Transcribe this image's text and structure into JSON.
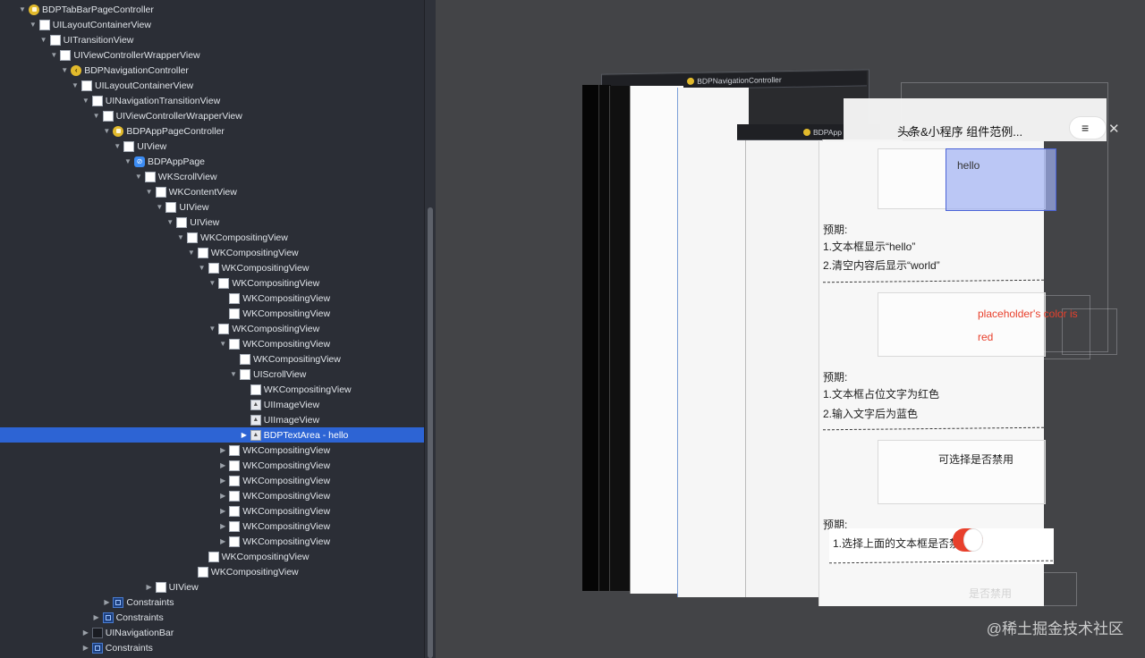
{
  "navigator": {
    "rows": [
      {
        "label": "BDPTabBarPageController",
        "indent": 0,
        "icon": "controller",
        "disclosure": "expanded"
      },
      {
        "label": "UILayoutContainerView",
        "indent": 1,
        "icon": "view",
        "disclosure": "expanded"
      },
      {
        "label": "UITransitionView",
        "indent": 2,
        "icon": "view",
        "disclosure": "expanded"
      },
      {
        "label": "UIViewControllerWrapperView",
        "indent": 3,
        "icon": "view",
        "disclosure": "expanded"
      },
      {
        "label": "BDPNavigationController",
        "indent": 4,
        "icon": "nav-controller",
        "disclosure": "expanded"
      },
      {
        "label": "UILayoutContainerView",
        "indent": 5,
        "icon": "view",
        "disclosure": "expanded"
      },
      {
        "label": "UINavigationTransitionView",
        "indent": 6,
        "icon": "view",
        "disclosure": "expanded"
      },
      {
        "label": "UIViewControllerWrapperView",
        "indent": 7,
        "icon": "view",
        "disclosure": "expanded"
      },
      {
        "label": "BDPAppPageController",
        "indent": 8,
        "icon": "controller",
        "disclosure": "expanded"
      },
      {
        "label": "UIView",
        "indent": 9,
        "icon": "view",
        "disclosure": "expanded"
      },
      {
        "label": "BDPAppPage",
        "indent": 10,
        "icon": "web",
        "disclosure": "expanded"
      },
      {
        "label": "WKScrollView",
        "indent": 11,
        "icon": "view",
        "disclosure": "expanded"
      },
      {
        "label": "WKContentView",
        "indent": 12,
        "icon": "view",
        "disclosure": "expanded"
      },
      {
        "label": "UIView",
        "indent": 13,
        "icon": "view",
        "disclosure": "expanded"
      },
      {
        "label": "UIView",
        "indent": 14,
        "icon": "view",
        "disclosure": "expanded"
      },
      {
        "label": "WKCompositingView",
        "indent": 15,
        "icon": "view",
        "disclosure": "expanded"
      },
      {
        "label": "WKCompositingView",
        "indent": 16,
        "icon": "view",
        "disclosure": "expanded"
      },
      {
        "label": "WKCompositingView",
        "indent": 17,
        "icon": "view",
        "disclosure": "expanded"
      },
      {
        "label": "WKCompositingView",
        "indent": 18,
        "icon": "view",
        "disclosure": "expanded"
      },
      {
        "label": "WKCompositingView",
        "indent": 19,
        "icon": "view",
        "disclosure": "none"
      },
      {
        "label": "WKCompositingView",
        "indent": 19,
        "icon": "view",
        "disclosure": "none"
      },
      {
        "label": "WKCompositingView",
        "indent": 18,
        "icon": "view",
        "disclosure": "expanded"
      },
      {
        "label": "WKCompositingView",
        "indent": 19,
        "icon": "view",
        "disclosure": "expanded"
      },
      {
        "label": "WKCompositingView",
        "indent": 20,
        "icon": "view",
        "disclosure": "none"
      },
      {
        "label": "UIScrollView",
        "indent": 20,
        "icon": "view",
        "disclosure": "expanded"
      },
      {
        "label": "WKCompositingView",
        "indent": 21,
        "icon": "view",
        "disclosure": "none"
      },
      {
        "label": "UIImageView",
        "indent": 21,
        "icon": "image",
        "disclosure": "none"
      },
      {
        "label": "UIImageView",
        "indent": 21,
        "icon": "image",
        "disclosure": "none"
      },
      {
        "label": "BDPTextArea - hello",
        "indent": 21,
        "icon": "image",
        "disclosure": "collapsed",
        "selected": true
      },
      {
        "label": "WKCompositingView",
        "indent": 19,
        "icon": "view",
        "disclosure": "collapsed"
      },
      {
        "label": "WKCompositingView",
        "indent": 19,
        "icon": "view",
        "disclosure": "collapsed"
      },
      {
        "label": "WKCompositingView",
        "indent": 19,
        "icon": "view",
        "disclosure": "collapsed"
      },
      {
        "label": "WKCompositingView",
        "indent": 19,
        "icon": "view",
        "disclosure": "collapsed"
      },
      {
        "label": "WKCompositingView",
        "indent": 19,
        "icon": "view",
        "disclosure": "collapsed"
      },
      {
        "label": "WKCompositingView",
        "indent": 19,
        "icon": "view",
        "disclosure": "collapsed"
      },
      {
        "label": "WKCompositingView",
        "indent": 19,
        "icon": "view",
        "disclosure": "collapsed"
      },
      {
        "label": "WKCompositingView",
        "indent": 17,
        "icon": "view",
        "disclosure": "none"
      },
      {
        "label": "WKCompositingView",
        "indent": 16,
        "icon": "view",
        "disclosure": "none"
      },
      {
        "label": "UIView",
        "indent": 12,
        "icon": "view",
        "disclosure": "collapsed"
      },
      {
        "label": "Constraints",
        "indent": 8,
        "icon": "constraints",
        "disclosure": "collapsed"
      },
      {
        "label": "Constraints",
        "indent": 7,
        "icon": "constraints",
        "disclosure": "collapsed"
      },
      {
        "label": "UINavigationBar",
        "indent": 6,
        "icon": "navbar",
        "disclosure": "collapsed"
      },
      {
        "label": "Constraints",
        "indent": 6,
        "icon": "constraints",
        "disclosure": "collapsed"
      }
    ]
  },
  "canvas": {
    "nav_controller_label": "BDPNavigationController",
    "app_page_label": "BDPApp",
    "mini_title": "头条&小程序 组件范例...",
    "menu_icon": "≡",
    "close_icon": "✕",
    "textarea_hello": "hello",
    "expect_label_1": "预期:",
    "expect_1_line_1": "1.文本框显示“hello”",
    "expect_1_line_2": "2.清空内容后显示“world”",
    "placeholder_line_1": "placeholder's color is",
    "placeholder_line_2": "red",
    "expect_label_2": "预期:",
    "expect_2_line_1": "1.文本框占位文字为红色",
    "expect_2_line_2": "2.输入文字后为蓝色",
    "selectable_label": "可选择是否禁用",
    "expect_label_3": "预期:",
    "expect_3_line_1": "1.选择上面的文本框是否禁用",
    "bottom_faded": "是否禁用",
    "accent_red": "#e8402c",
    "highlight_blue": "#9fb0f2"
  },
  "watermark": "@稀土掘金技术社区"
}
